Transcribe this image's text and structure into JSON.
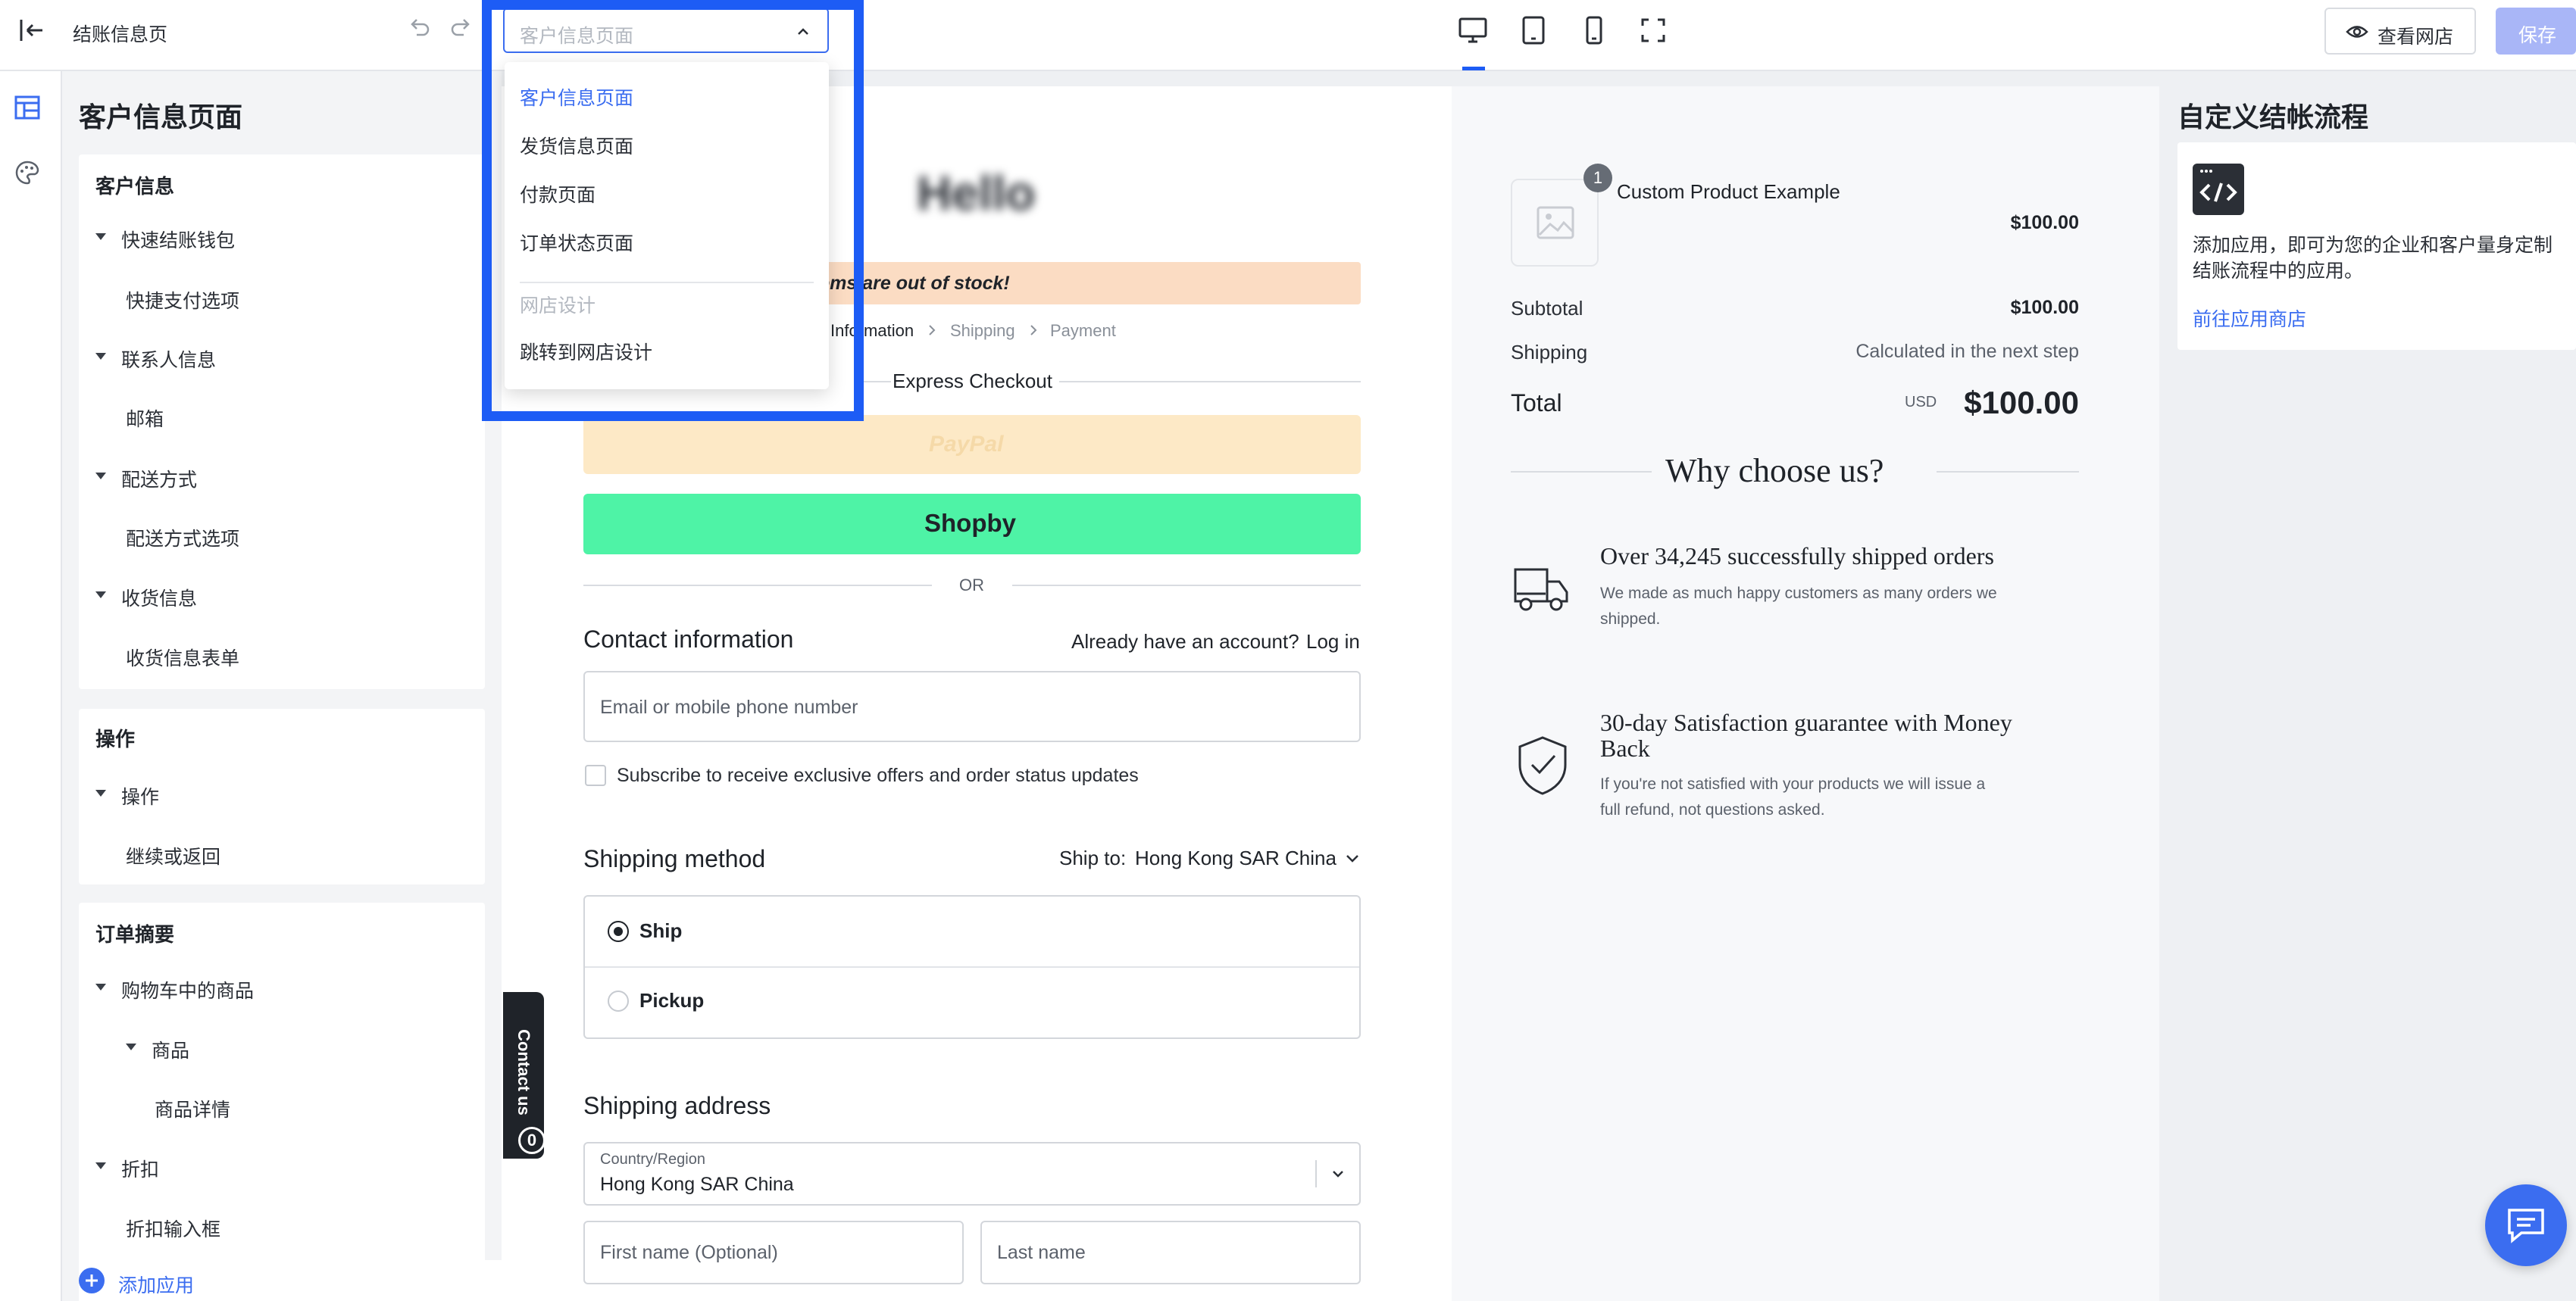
{
  "topbar": {
    "title": "结账信息页",
    "page_select_value": "客户信息页面",
    "view_store_label": "查看网店",
    "save_label": "保存"
  },
  "sidebar": {
    "heading": "客户信息页面",
    "sections": [
      {
        "title": "客户信息",
        "items": [
          "快速结账钱包",
          "快捷支付选项",
          "联系人信息",
          "邮箱",
          "配送方式",
          "配送方式选项",
          "收货信息",
          "收货信息表单"
        ]
      },
      {
        "title": "操作",
        "items": [
          "操作",
          "继续或返回"
        ]
      },
      {
        "title": "订单摘要",
        "items": [
          "购物车中的商品",
          "商品",
          "商品详情",
          "折扣",
          "折扣输入框"
        ]
      }
    ],
    "add_app_label": "添加应用"
  },
  "dropdown": {
    "items": [
      "客户信息页面",
      "发货信息页面",
      "付款页面",
      "订单状态页面"
    ],
    "group_label": "网店设计",
    "jump_label": "跳转到网店设计"
  },
  "checkout": {
    "logo_text": "Hello",
    "stock_banner": "items are out of stock!",
    "breadcrumb": [
      "Information",
      "Shipping",
      "Payment"
    ],
    "express_checkout": "Express Checkout",
    "paypal_label": "PayPal",
    "shopby_label": "Shopby",
    "or_label": "OR",
    "contact_heading": "Contact information",
    "have_account": "Already have an account?",
    "login_label": "Log in",
    "email_placeholder": "Email or mobile phone number",
    "subscribe_label": "Subscribe to receive exclusive offers and order status updates",
    "shipping_method_heading": "Shipping method",
    "ship_to_label": "Ship to:",
    "ship_to_value": "Hong Kong SAR China",
    "option_ship": "Ship",
    "option_pickup": "Pickup",
    "shipping_address_heading": "Shipping address",
    "country_label": "Country/Region",
    "country_value": "Hong Kong SAR China",
    "first_name_placeholder": "First name (Optional)",
    "last_name_placeholder": "Last name",
    "contact_us_label": "Contact us",
    "contact_us_count": "0"
  },
  "summary": {
    "product_qty": "1",
    "product_name": "Custom Product Example",
    "product_price": "$100.00",
    "subtotal_label": "Subtotal",
    "subtotal_value": "$100.00",
    "shipping_label": "Shipping",
    "shipping_value": "Calculated in the next step",
    "total_label": "Total",
    "currency": "USD",
    "total_value": "$100.00",
    "why_heading": "Why choose us?",
    "features": [
      {
        "title": "Over 34,245 successfully shipped orders",
        "desc_1": "We made as much happy customers as many orders we",
        "desc_2": "shipped."
      },
      {
        "title": "30-day Satisfaction guarantee with Money",
        "title_2": "Back",
        "desc_1": "If you're not satisfied with your products we will issue a",
        "desc_2": "full refund, not questions asked."
      }
    ]
  },
  "right_panel": {
    "heading": "自定义结帐流程",
    "desc_1": "添加应用，即可为您的企业和客户量身定制",
    "desc_2": "结账流程中的应用。",
    "link": "前往应用商店"
  },
  "colors": {
    "primary": "#1d5cf5",
    "link": "#3b6df0",
    "paypal_bg": "#fde9c6",
    "shopby_bg": "#4ef3a6",
    "stock_bg": "#fbdcc3",
    "save_bg": "#a9b6f7"
  }
}
